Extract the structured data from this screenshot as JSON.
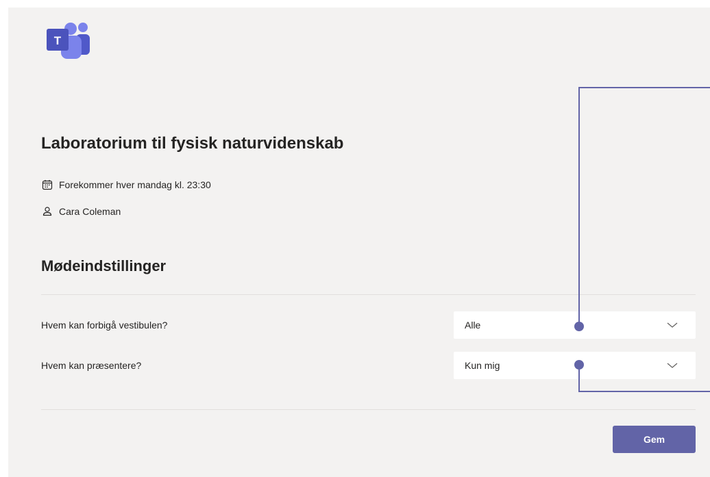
{
  "meeting": {
    "title": "Laboratorium til fysisk naturvidenskab",
    "recurrence": "Forekommer hver mandag kl. 23:30",
    "organizer": "Cara Coleman"
  },
  "settings": {
    "heading": "Mødeindstillinger",
    "lobby": {
      "label": "Hvem kan forbigå vestibulen?",
      "value": "Alle"
    },
    "presenter": {
      "label": "Hvem kan præsentere?",
      "value": "Kun mig"
    }
  },
  "actions": {
    "save_label": "Gem"
  },
  "icons": {
    "logo": "microsoft-teams-logo",
    "recurrence": "calendar-icon",
    "organizer": "person-icon",
    "dropdown": "chevron-down-icon"
  },
  "colors": {
    "accent": "#6264a7",
    "panel_background": "#f3f2f1",
    "text": "#252423"
  }
}
